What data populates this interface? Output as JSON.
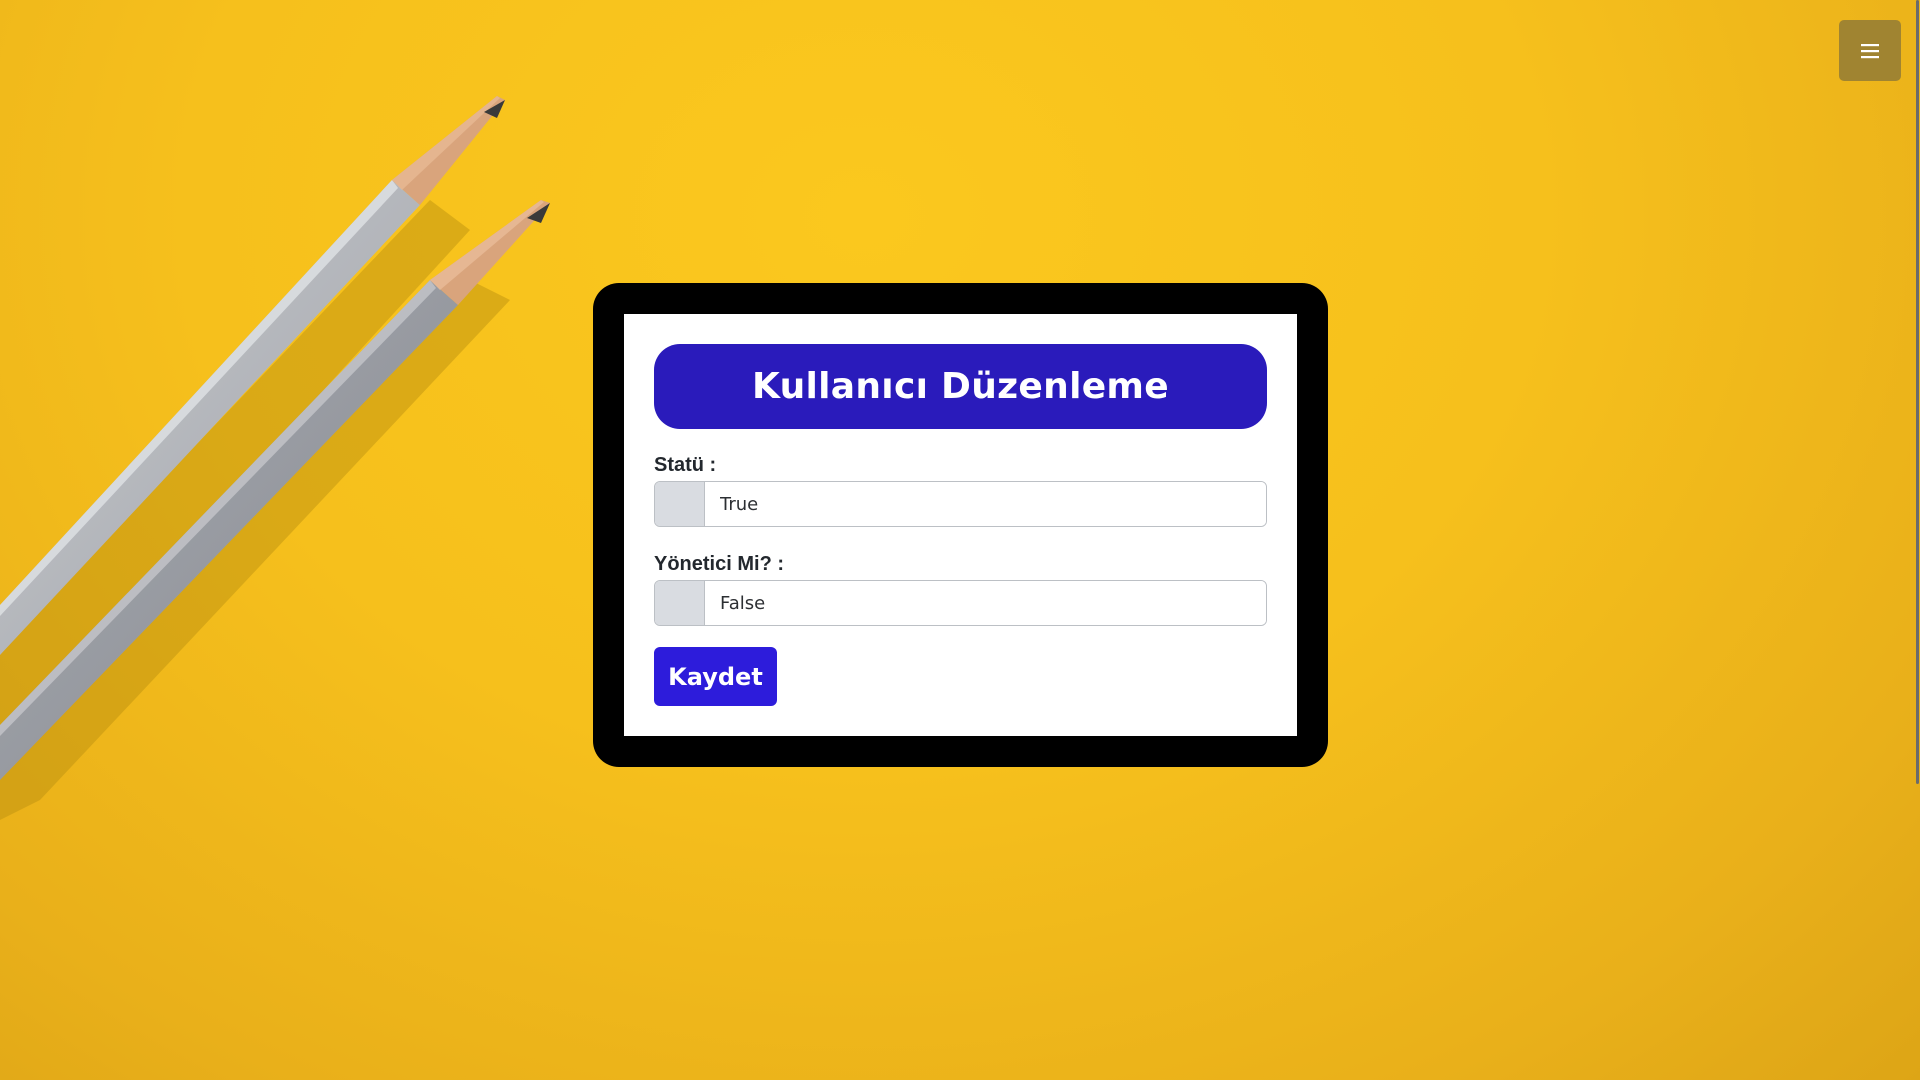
{
  "menu": {
    "icon": "hamburger-menu-icon"
  },
  "form": {
    "title": "Kullanıcı Düzenleme",
    "status_label": "Statü :",
    "status_value": "True",
    "admin_label": "Yönetici Mi? :",
    "admin_value": "False",
    "save_label": "Kaydet"
  },
  "colors": {
    "background": "#f6c01c",
    "title_bar": "#2a1bbb",
    "save_button": "#2d1cdb",
    "menu_button": "#a08431",
    "frame": "#000000"
  }
}
